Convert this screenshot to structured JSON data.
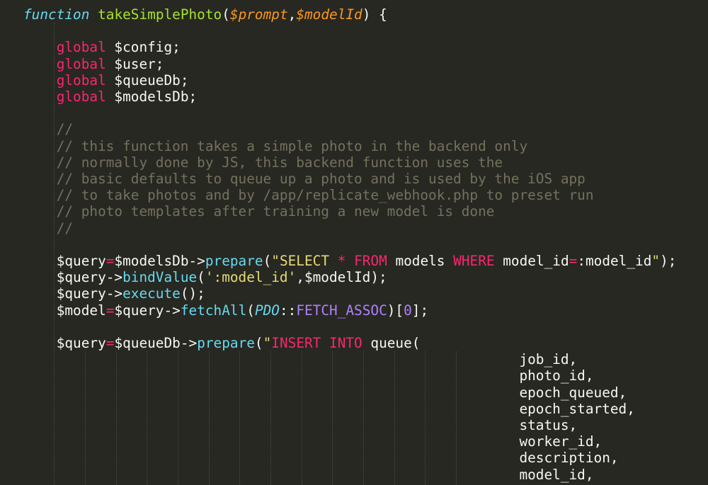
{
  "editor": {
    "theme": "monokai",
    "colors": {
      "background": "#272822",
      "foreground": "#f8f8f2",
      "keyword": "#f92672",
      "function_keyword": "#66d9ef",
      "function_name": "#a6e22e",
      "parameter": "#fd971f",
      "comment": "#75715e",
      "string": "#e6db74",
      "number": "#ae81ff"
    },
    "lines": [
      {
        "tokens": [
          [
            "kw-fn",
            "function"
          ],
          [
            "plain",
            " "
          ],
          [
            "fn",
            "takeSimplePhoto"
          ],
          [
            "plain",
            "("
          ],
          [
            "param",
            "$prompt"
          ],
          [
            "plain",
            ","
          ],
          [
            "param",
            "$modelId"
          ],
          [
            "plain",
            ") {"
          ]
        ]
      },
      {
        "tokens": []
      },
      {
        "tokens": [
          [
            "plain",
            "    "
          ],
          [
            "kw",
            "global"
          ],
          [
            "plain",
            " $config;"
          ]
        ]
      },
      {
        "tokens": [
          [
            "plain",
            "    "
          ],
          [
            "kw",
            "global"
          ],
          [
            "plain",
            " $user;"
          ]
        ]
      },
      {
        "tokens": [
          [
            "plain",
            "    "
          ],
          [
            "kw",
            "global"
          ],
          [
            "plain",
            " $queueDb;"
          ]
        ]
      },
      {
        "tokens": [
          [
            "plain",
            "    "
          ],
          [
            "kw",
            "global"
          ],
          [
            "plain",
            " $modelsDb;"
          ]
        ]
      },
      {
        "tokens": []
      },
      {
        "tokens": [
          [
            "cm",
            "    //"
          ]
        ]
      },
      {
        "tokens": [
          [
            "cm",
            "    // this function takes a simple photo in the backend only"
          ]
        ]
      },
      {
        "tokens": [
          [
            "cm",
            "    // normally done by JS, this backend function uses the"
          ]
        ]
      },
      {
        "tokens": [
          [
            "cm",
            "    // basic defaults to queue up a photo and is used by the iOS app"
          ]
        ]
      },
      {
        "tokens": [
          [
            "cm",
            "    // to take photos and by /app/replicate_webhook.php to preset run"
          ]
        ]
      },
      {
        "tokens": [
          [
            "cm",
            "    // photo templates after training a new model is done"
          ]
        ]
      },
      {
        "tokens": [
          [
            "cm",
            "    //"
          ]
        ]
      },
      {
        "tokens": []
      },
      {
        "tokens": [
          [
            "plain",
            "    $query"
          ],
          [
            "kw",
            "="
          ],
          [
            "plain",
            "$modelsDb->"
          ],
          [
            "call",
            "prepare"
          ],
          [
            "plain",
            "("
          ],
          [
            "str",
            "\"SELECT "
          ],
          [
            "kw",
            "*"
          ],
          [
            "str",
            " "
          ],
          [
            "kw",
            "FROM"
          ],
          [
            "plain",
            " models "
          ],
          [
            "kw",
            "WHERE"
          ],
          [
            "plain",
            " model_id"
          ],
          [
            "kw",
            "="
          ],
          [
            "plain",
            ":model_id"
          ],
          [
            "str",
            "\""
          ],
          [
            "plain",
            ");"
          ]
        ]
      },
      {
        "tokens": [
          [
            "plain",
            "    $query->"
          ],
          [
            "call",
            "bindValue"
          ],
          [
            "plain",
            "("
          ],
          [
            "str",
            "':model_id'"
          ],
          [
            "plain",
            ",$modelId);"
          ]
        ]
      },
      {
        "tokens": [
          [
            "plain",
            "    $query->"
          ],
          [
            "call",
            "execute"
          ],
          [
            "plain",
            "();"
          ]
        ]
      },
      {
        "tokens": [
          [
            "plain",
            "    $model"
          ],
          [
            "kw",
            "="
          ],
          [
            "plain",
            "$query->"
          ],
          [
            "call",
            "fetchAll"
          ],
          [
            "plain",
            "("
          ],
          [
            "cls",
            "PDO"
          ],
          [
            "plain",
            "::"
          ],
          [
            "const",
            "FETCH_ASSOC"
          ],
          [
            "plain",
            ")["
          ],
          [
            "num",
            "0"
          ],
          [
            "plain",
            "];"
          ]
        ]
      },
      {
        "tokens": []
      },
      {
        "tokens": [
          [
            "plain",
            "    $query"
          ],
          [
            "kw",
            "="
          ],
          [
            "plain",
            "$queueDb->"
          ],
          [
            "call",
            "prepare"
          ],
          [
            "plain",
            "("
          ],
          [
            "str",
            "\""
          ],
          [
            "kw",
            "INSERT INTO"
          ],
          [
            "plain",
            " queue("
          ]
        ]
      },
      {
        "tokens": [
          [
            "plain",
            "                                                            job_id,"
          ]
        ]
      },
      {
        "tokens": [
          [
            "plain",
            "                                                            photo_id,"
          ]
        ]
      },
      {
        "tokens": [
          [
            "plain",
            "                                                            epoch_queued,"
          ]
        ]
      },
      {
        "tokens": [
          [
            "plain",
            "                                                            epoch_started,"
          ]
        ]
      },
      {
        "tokens": [
          [
            "plain",
            "                                                            status,"
          ]
        ]
      },
      {
        "tokens": [
          [
            "plain",
            "                                                            worker_id,"
          ]
        ]
      },
      {
        "tokens": [
          [
            "plain",
            "                                                            description,"
          ]
        ]
      },
      {
        "tokens": [
          [
            "plain",
            "                                                            model_id,"
          ]
        ]
      }
    ]
  }
}
